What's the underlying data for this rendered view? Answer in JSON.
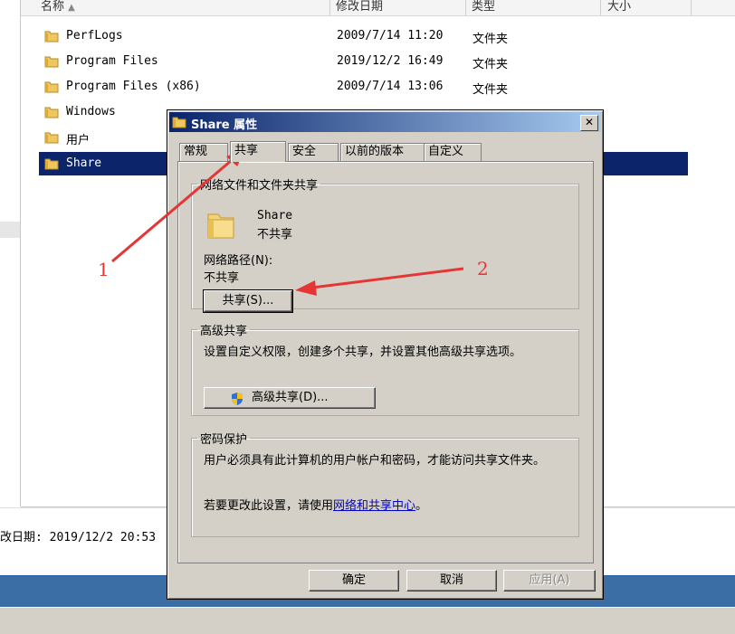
{
  "explorer": {
    "columns": {
      "name": "名称",
      "date": "修改日期",
      "type": "类型",
      "size": "大小"
    },
    "rows": [
      {
        "name": "PerfLogs",
        "date": "2009/7/14 11:20",
        "type": "文件夹",
        "selected": false
      },
      {
        "name": "Program Files",
        "date": "2019/12/2 16:49",
        "type": "文件夹",
        "selected": false
      },
      {
        "name": "Program Files (x86)",
        "date": "2009/7/14 13:06",
        "type": "文件夹",
        "selected": false
      },
      {
        "name": "Windows",
        "date": "",
        "type": "",
        "selected": false
      },
      {
        "name": "用户",
        "date": "",
        "type": "",
        "selected": false
      },
      {
        "name": "Share",
        "date": "",
        "type": "",
        "selected": true
      }
    ],
    "details": {
      "modified_label": "改日期:",
      "modified_value": "2019/12/2 20:53"
    }
  },
  "dialog": {
    "title": "Share 属性",
    "close_glyph": "✕",
    "tabs": [
      "常规",
      "共享",
      "安全",
      "以前的版本",
      "自定义"
    ],
    "active_tab": 1,
    "sharing": {
      "legend": "网络文件和文件夹共享",
      "folder_name": "Share",
      "share_state": "不共享",
      "path_label": "网络路径(N):",
      "path_value": "不共享",
      "share_button": "共享(S)..."
    },
    "advanced": {
      "legend": "高级共享",
      "description": "设置自定义权限，创建多个共享，并设置其他高级共享选项。",
      "button": "高级共享(D)..."
    },
    "password": {
      "legend": "密码保护",
      "description": "用户必须具有此计算机的用户帐户和密码，才能访问共享文件夹。",
      "change_prefix": "若要更改此设置，请使用",
      "change_link": "网络和共享中心",
      "change_suffix": "。"
    },
    "buttons": {
      "ok": "确定",
      "cancel": "取消",
      "apply": "应用(A)"
    }
  },
  "annotations": {
    "label_1": "1",
    "label_2": "2",
    "arrow_color": "#e53535"
  }
}
